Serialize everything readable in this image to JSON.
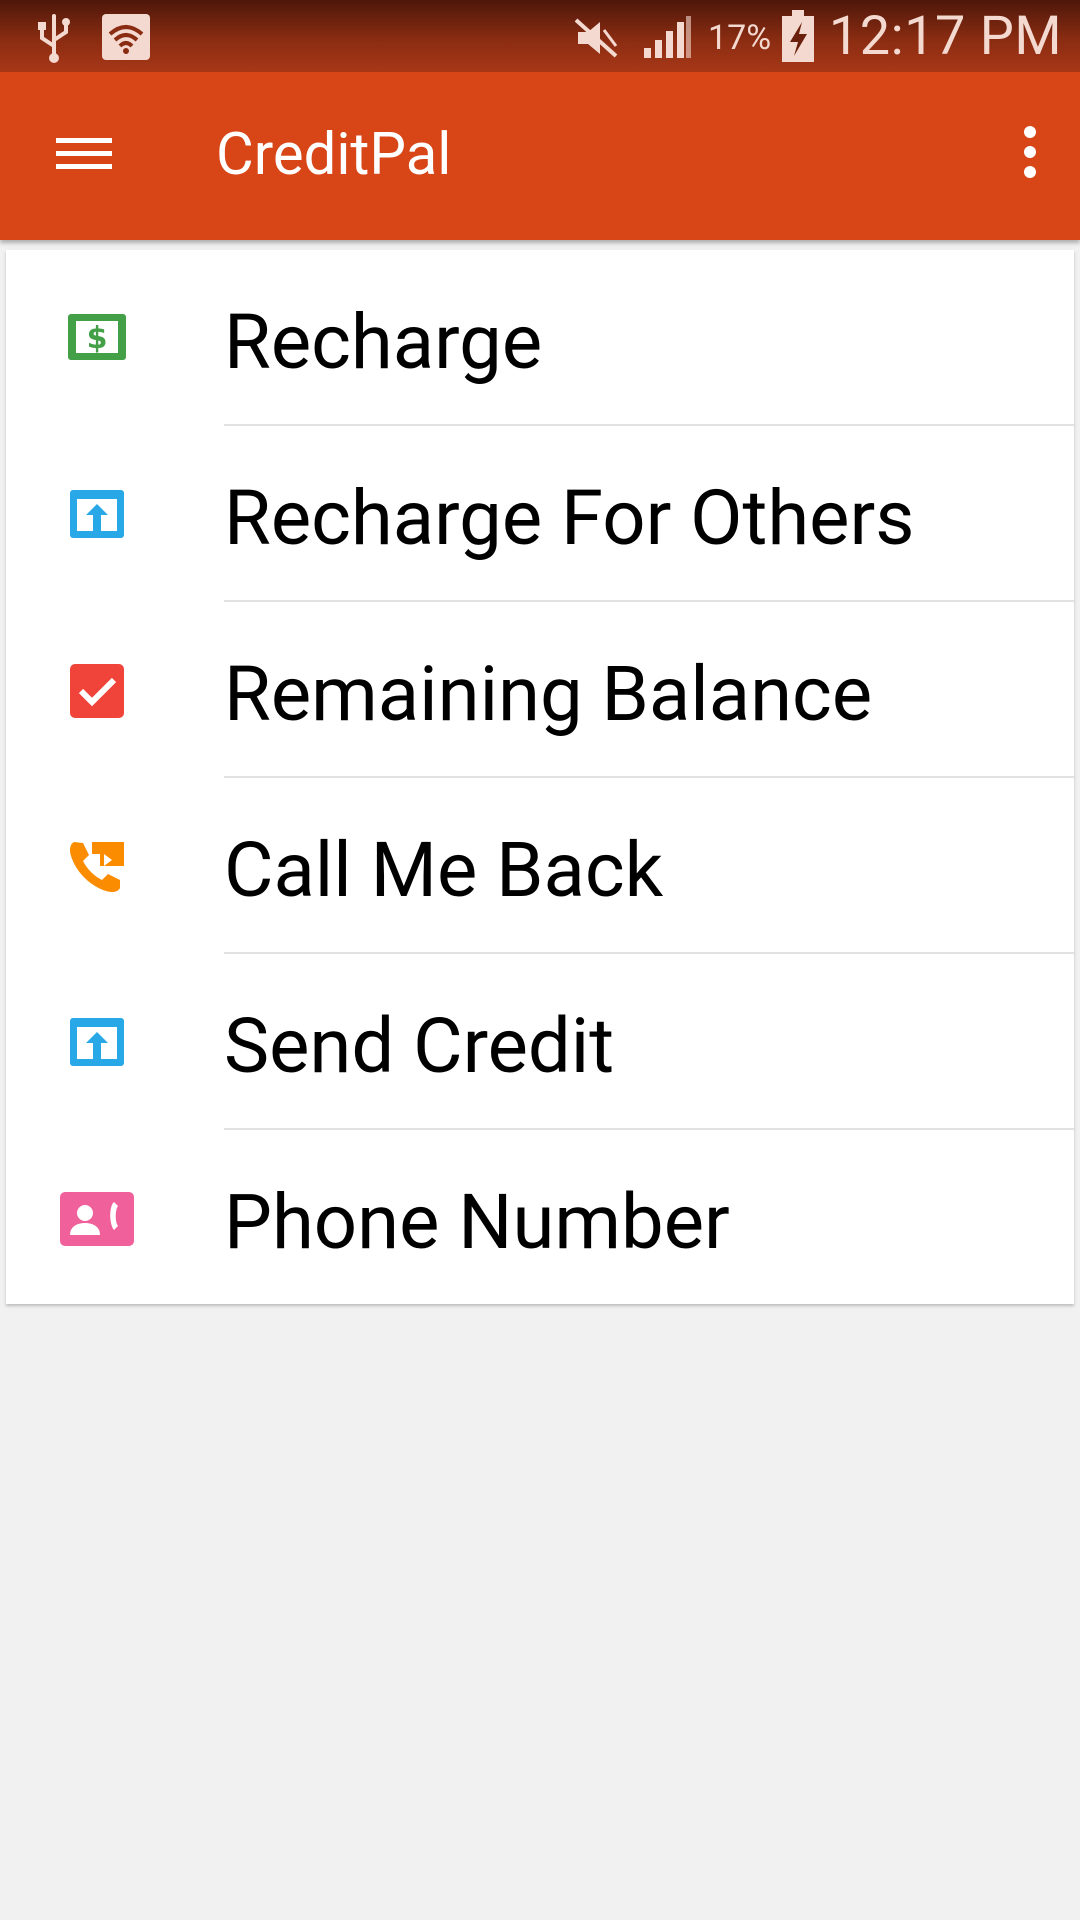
{
  "status_bar": {
    "battery_percent": "17%",
    "time": "12:17 PM",
    "icons": [
      "usb-icon",
      "wifi-icon",
      "mute-icon",
      "signal-icon",
      "battery-charging-icon"
    ]
  },
  "app_bar": {
    "title": "CreditPal",
    "menu_icon": "hamburger-menu-icon",
    "overflow_icon": "more-vert-icon",
    "color": "#d84516"
  },
  "menu": {
    "items": [
      {
        "label": "Recharge",
        "icon": "dollar-bill-icon",
        "color": "#43a047"
      },
      {
        "label": "Recharge For Others",
        "icon": "upload-screen-icon",
        "color": "#29a8e8"
      },
      {
        "label": "Remaining Balance",
        "icon": "checkbox-icon",
        "color": "#f0433a"
      },
      {
        "label": "Call Me Back",
        "icon": "phone-forward-icon",
        "color": "#fb8c00"
      },
      {
        "label": "Send Credit",
        "icon": "upload-screen-icon",
        "color": "#29a8e8"
      },
      {
        "label": "Phone Number",
        "icon": "contact-phone-icon",
        "color": "#f0609a"
      }
    ]
  }
}
